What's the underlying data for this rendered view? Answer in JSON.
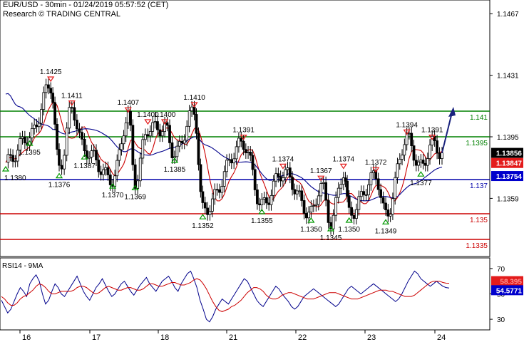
{
  "header": {
    "line1": "EUR/USD - 30min - 01/24/2019 05:57:52 (CET)",
    "line2": "Research © TRADING CENTRAL"
  },
  "rsi_panel": {
    "title": "RSI14 - 9MA"
  },
  "colors": {
    "price": "#000000",
    "moving_average_red": "#cc0000",
    "moving_average_blue": "#00008b",
    "support_line": "#cc0000",
    "resistance_line": "#008000",
    "pivot_line": "#0000aa",
    "last_price_badge": "#000000",
    "red_badge": "#e31b1b",
    "blue_badge": "#0000cc",
    "forecast_arrow": "#1a237e"
  },
  "chart_data": [
    {
      "type": "candlestick",
      "timeframe": "30min",
      "ylim": [
        1.1325,
        1.1475
      ],
      "y_ticks": [
        "1.1467",
        "1.1431",
        "1.1395",
        "1.1359"
      ],
      "x_tick_labels": [
        "16",
        "17",
        "18",
        "21",
        "22",
        "23",
        "24"
      ],
      "horizontal_levels": [
        {
          "value": 1.141,
          "label": "1.141",
          "color": "#008000"
        },
        {
          "value": 1.1395,
          "label": "1.1395",
          "color": "#008000"
        },
        {
          "value": 1.137,
          "label": "1.137",
          "color": "#0000aa"
        },
        {
          "value": 1.135,
          "label": "1.135",
          "color": "#cc0000"
        },
        {
          "value": 1.1335,
          "label": "1.1335",
          "color": "#cc0000"
        }
      ],
      "price_badges": [
        {
          "label": "1.13856",
          "color": "#000000",
          "text_color": "#ffffff"
        },
        {
          "label": "1.13847",
          "color": "#e31b1b",
          "text_color": "#ffffff"
        },
        {
          "label": "1.13754",
          "color": "#0000cc",
          "text_color": "#ffffff"
        }
      ],
      "swing_points": [
        {
          "x": 0.0,
          "price": 1.138,
          "label": "1.1380",
          "kind": "low"
        },
        {
          "x": 1.7,
          "price": 1.1395,
          "label": "1.1395",
          "kind": "low"
        },
        {
          "x": 3.2,
          "price": 1.1425,
          "label": "1.1425",
          "kind": "high"
        },
        {
          "x": 3.8,
          "price": 1.1376,
          "label": "1.1376",
          "kind": "low"
        },
        {
          "x": 4.7,
          "price": 1.1411,
          "label": "1.1411",
          "kind": "high"
        },
        {
          "x": 5.6,
          "price": 1.1387,
          "label": "1.1387",
          "kind": "low"
        },
        {
          "x": 7.6,
          "price": 1.137,
          "label": "1.1370",
          "kind": "low"
        },
        {
          "x": 8.7,
          "price": 1.1407,
          "label": "1.1407",
          "kind": "high"
        },
        {
          "x": 9.2,
          "price": 1.1369,
          "label": "1.1369",
          "kind": "low"
        },
        {
          "x": 10.1,
          "price": 1.14,
          "label": "1.1400",
          "kind": "high"
        },
        {
          "x": 11.3,
          "price": 1.14,
          "label": "1.1400",
          "kind": "high"
        },
        {
          "x": 12.0,
          "price": 1.1385,
          "label": "1.1385",
          "kind": "low"
        },
        {
          "x": 13.4,
          "price": 1.141,
          "label": "1.1410",
          "kind": "high"
        },
        {
          "x": 14.0,
          "price": 1.1352,
          "label": "1.1352",
          "kind": "low"
        },
        {
          "x": 16.9,
          "price": 1.1391,
          "label": "1.1391",
          "kind": "high"
        },
        {
          "x": 18.2,
          "price": 1.1355,
          "label": "1.1355",
          "kind": "low"
        },
        {
          "x": 19.7,
          "price": 1.1374,
          "label": "1.1374",
          "kind": "high"
        },
        {
          "x": 21.7,
          "price": 1.135,
          "label": "1.1350",
          "kind": "low"
        },
        {
          "x": 22.4,
          "price": 1.1367,
          "label": "1.1367",
          "kind": "high"
        },
        {
          "x": 23.1,
          "price": 1.1345,
          "label": "1.1345",
          "kind": "low"
        },
        {
          "x": 24.0,
          "price": 1.1374,
          "label": "1.1374",
          "kind": "high"
        },
        {
          "x": 24.4,
          "price": 1.135,
          "label": "1.1350",
          "kind": "low"
        },
        {
          "x": 26.3,
          "price": 1.1372,
          "label": "1.1372",
          "kind": "high"
        },
        {
          "x": 27.0,
          "price": 1.1349,
          "label": "1.1349",
          "kind": "low"
        },
        {
          "x": 28.5,
          "price": 1.1394,
          "label": "1.1394",
          "kind": "high"
        },
        {
          "x": 29.5,
          "price": 1.1377,
          "label": "1.1377",
          "kind": "low"
        },
        {
          "x": 30.3,
          "price": 1.1391,
          "label": "1.1391",
          "kind": "high"
        },
        {
          "x": 31.0,
          "price": 1.13856,
          "label": "",
          "kind": "close"
        }
      ]
    },
    {
      "type": "line",
      "title": "RSI14 - 9MA",
      "ylim": [
        25,
        75
      ],
      "y_ticks": [
        "70",
        "50",
        "30"
      ],
      "price_badges": [
        {
          "label": "58.395",
          "color": "#e31b1b",
          "text_color": "#ff9999"
        },
        {
          "label": "54.5771",
          "color": "#0000cc",
          "text_color": "#ffffff"
        }
      ],
      "rsi_values": [
        45,
        40,
        35,
        38,
        44,
        50,
        55,
        52,
        48,
        58,
        62,
        65,
        60,
        50,
        42,
        45,
        52,
        58,
        55,
        50,
        48,
        52,
        56,
        60,
        64,
        58,
        52,
        48,
        45,
        50,
        55,
        58,
        62,
        57,
        52,
        48,
        50,
        54,
        58,
        60,
        56,
        52,
        49,
        53,
        57,
        60,
        63,
        58,
        55,
        52,
        56,
        60,
        62,
        64,
        60,
        55,
        52,
        58,
        62,
        66,
        68,
        62,
        55,
        45,
        38,
        30,
        28,
        32,
        38,
        42,
        46,
        44,
        42,
        46,
        50,
        54,
        58,
        62,
        60,
        55,
        50,
        45,
        42,
        40,
        44,
        48,
        52,
        56,
        54,
        50,
        47,
        44,
        40,
        38,
        40,
        44,
        48,
        50,
        52,
        54,
        52,
        50,
        48,
        46,
        44,
        42,
        40,
        42,
        46,
        50,
        54,
        56,
        54,
        52,
        50,
        52,
        54,
        56,
        58,
        56,
        54,
        52,
        50,
        48,
        46,
        44,
        46,
        50,
        55,
        60,
        64,
        68,
        66,
        62,
        60,
        58,
        56,
        58,
        60,
        58,
        56,
        55,
        54.6
      ],
      "ma_values": [
        48,
        46,
        43,
        41,
        41,
        43,
        46,
        48,
        49,
        51,
        53,
        56,
        58,
        57,
        55,
        52,
        50,
        50,
        51,
        52,
        52,
        52,
        52,
        53,
        55,
        56,
        56,
        55,
        53,
        51,
        50,
        51,
        53,
        55,
        56,
        55,
        54,
        53,
        53,
        54,
        55,
        55,
        54,
        53,
        53,
        54,
        56,
        58,
        58,
        57,
        56,
        56,
        57,
        58,
        59,
        59,
        58,
        57,
        57,
        58,
        59,
        61,
        62,
        61,
        58,
        54,
        49,
        44,
        40,
        37,
        36,
        37,
        38,
        40,
        41,
        43,
        45,
        48,
        51,
        53,
        55,
        55,
        54,
        52,
        49,
        47,
        46,
        46,
        47,
        49,
        50,
        51,
        51,
        50,
        49,
        48,
        47,
        46,
        46,
        46,
        47,
        48,
        49,
        50,
        51,
        51,
        51,
        50,
        49,
        48,
        47,
        46,
        46,
        46,
        47,
        48,
        49,
        50,
        51,
        52,
        53,
        53,
        53,
        52,
        52,
        51,
        50,
        49,
        48,
        48,
        48,
        49,
        51,
        53,
        55,
        57,
        59,
        60,
        60,
        60,
        59,
        58.5,
        58.4
      ]
    }
  ]
}
